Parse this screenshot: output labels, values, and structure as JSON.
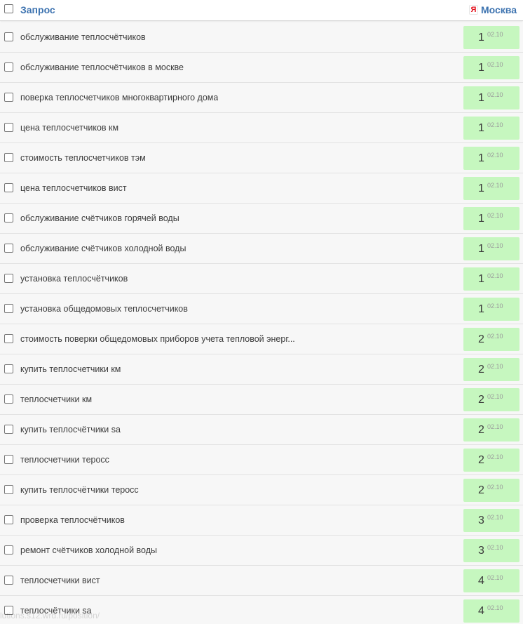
{
  "header": {
    "query_label": "Запрос",
    "region_label": "Москва",
    "region_icon": "yandex-icon",
    "region_icon_glyph": "Я"
  },
  "colors": {
    "accent": "#3d73b0",
    "position_bg": "#c6f7bf",
    "row_bg": "#f7f7f7",
    "yandex_red": "#e30b17"
  },
  "rows": [
    {
      "query": "обслуживание теплосчётчиков",
      "position": "1",
      "date": "02.10"
    },
    {
      "query": "обслуживание теплосчётчиков в москве",
      "position": "1",
      "date": "02.10"
    },
    {
      "query": "поверка теплосчетчиков многоквартирного дома",
      "position": "1",
      "date": "02.10"
    },
    {
      "query": "цена теплосчетчиков км",
      "position": "1",
      "date": "02.10"
    },
    {
      "query": "стоимость теплосчетчиков тэм",
      "position": "1",
      "date": "02.10"
    },
    {
      "query": "цена теплосчетчиков вист",
      "position": "1",
      "date": "02.10"
    },
    {
      "query": "обслуживание счётчиков горячей воды",
      "position": "1",
      "date": "02.10"
    },
    {
      "query": "обслуживание счётчиков холодной воды",
      "position": "1",
      "date": "02.10"
    },
    {
      "query": "установка теплосчётчиков",
      "position": "1",
      "date": "02.10"
    },
    {
      "query": "установка общедомовых теплосчетчиков",
      "position": "1",
      "date": "02.10"
    },
    {
      "query": "стоимость поверки общедомовых приборов учета тепловой энерг...",
      "position": "2",
      "date": "02.10"
    },
    {
      "query": "купить теплосчетчики км",
      "position": "2",
      "date": "02.10"
    },
    {
      "query": "теплосчетчики км",
      "position": "2",
      "date": "02.10"
    },
    {
      "query": "купить теплосчётчики sa",
      "position": "2",
      "date": "02.10"
    },
    {
      "query": "теплосчетчики теросс",
      "position": "2",
      "date": "02.10"
    },
    {
      "query": "купить теплосчётчики теросс",
      "position": "2",
      "date": "02.10"
    },
    {
      "query": "проверка теплосчётчиков",
      "position": "3",
      "date": "02.10"
    },
    {
      "query": "ремонт счётчиков холодной воды",
      "position": "3",
      "date": "02.10"
    },
    {
      "query": "теплосчетчики вист",
      "position": "4",
      "date": "02.10"
    },
    {
      "query": "теплосчётчики sa",
      "position": "4",
      "date": "02.10"
    }
  ],
  "watermark": "lutions.s12.wrd.ru/position/"
}
